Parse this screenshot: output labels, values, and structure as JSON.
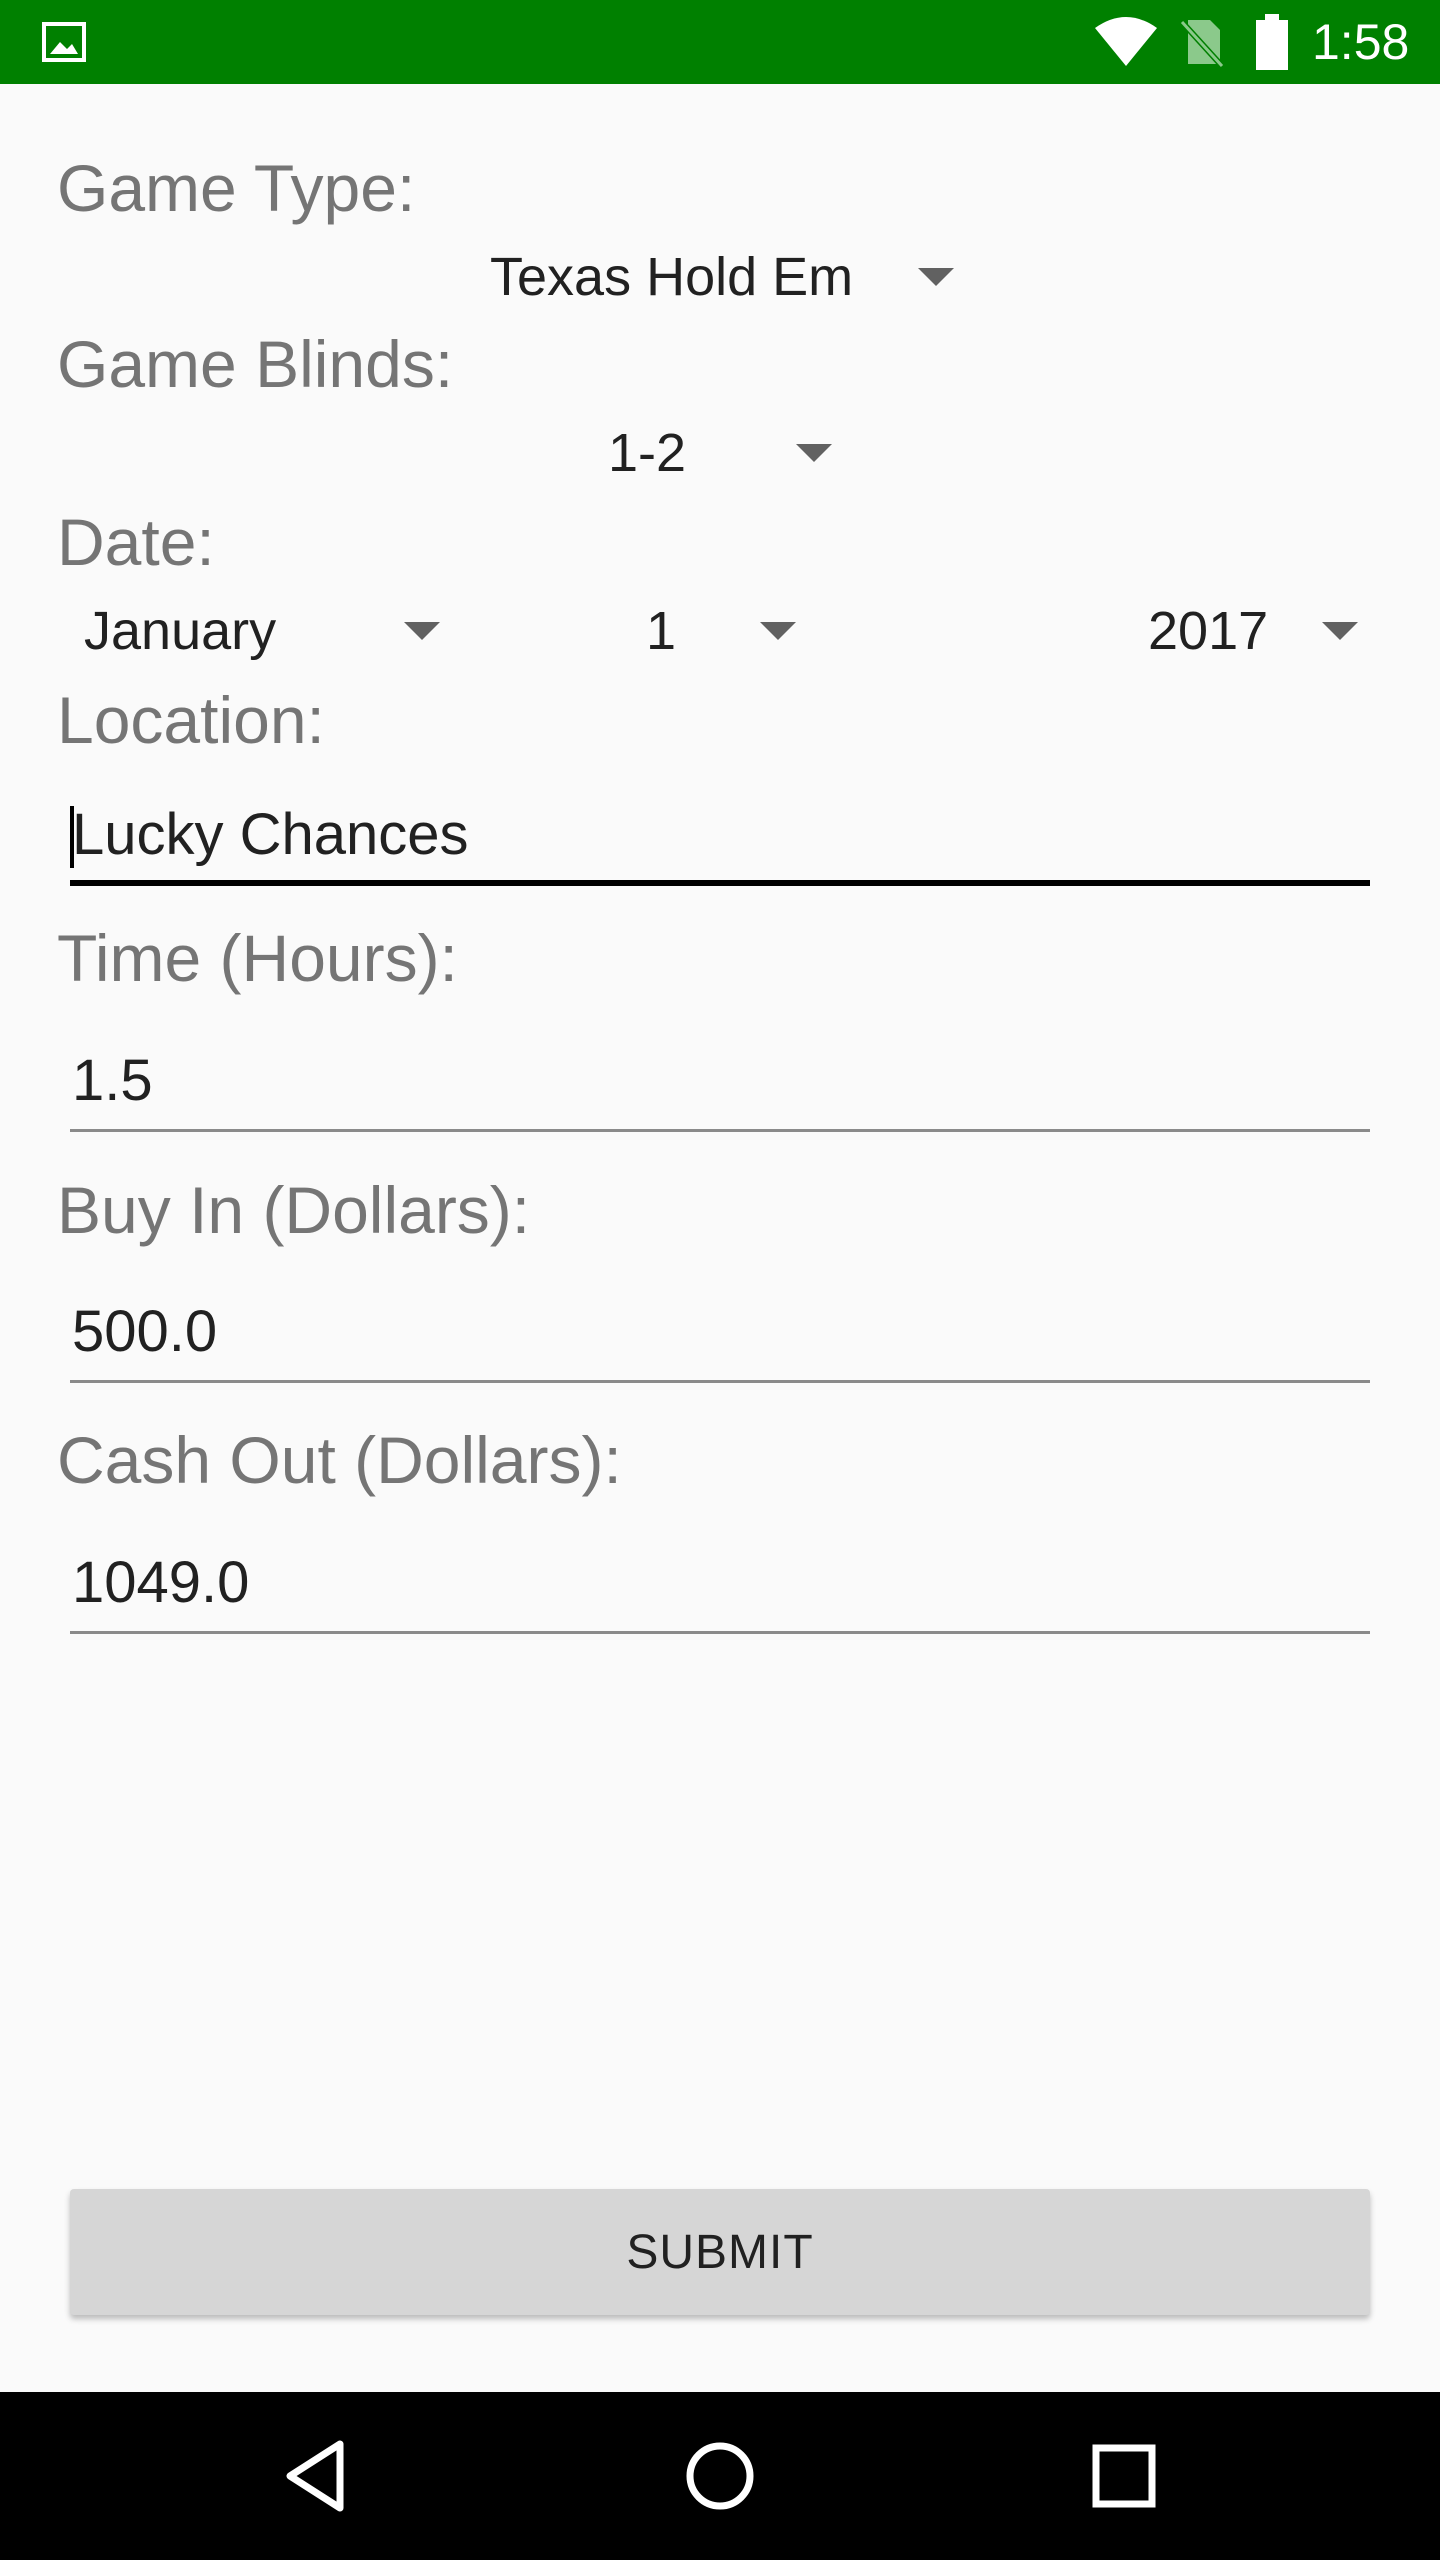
{
  "status_bar": {
    "time": "1:58",
    "icons": [
      "image-icon",
      "wifi-icon",
      "no-sim-icon",
      "battery-icon"
    ]
  },
  "form": {
    "game_type": {
      "label": "Game Type:",
      "selected": "Texas Hold Em"
    },
    "game_blinds": {
      "label": "Game Blinds:",
      "selected": "1-2"
    },
    "date": {
      "label": "Date:",
      "month": "January",
      "day": "1",
      "year": "2017"
    },
    "location": {
      "label": "Location:",
      "value": "Lucky Chances"
    },
    "time_hours": {
      "label": "Time (Hours):",
      "value": "1.5"
    },
    "buy_in": {
      "label": "Buy In (Dollars):",
      "value": "500.0"
    },
    "cash_out": {
      "label": "Cash Out (Dollars):",
      "value": "1049.0"
    },
    "submit_label": "SUBMIT"
  },
  "nav_bar": {
    "buttons": [
      "back-icon",
      "home-icon",
      "recents-icon"
    ]
  },
  "colors": {
    "status_bar": "#008000",
    "background": "#fafafa",
    "label_text": "#757575",
    "button_bg": "#d6d6d6",
    "nav_bar": "#000000"
  }
}
